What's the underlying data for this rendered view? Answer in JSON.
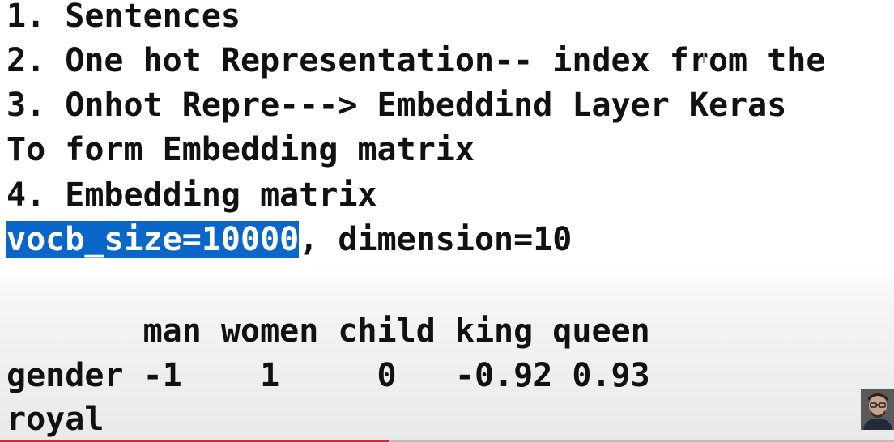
{
  "lines": [
    "1. Sentences",
    "2. One hot Representation-- index from the",
    "3. Onhot Repre---> Embeddind Layer Keras",
    "To form Embedding matrix",
    "4. Embedding matrix"
  ],
  "selection_line": {
    "selected_text": "vocb_size=10000",
    "rest_text": ", dimension=10"
  },
  "table_header": "       man women child king queen",
  "table_rows": [
    "gender -1    1     0   -0.92 0.93",
    "royal"
  ],
  "colors": {
    "selection": "#0a66c9",
    "progress": "#e0242b",
    "text": "#111111"
  },
  "video_progress": 0.435,
  "icons": {
    "cursor": "i-beam-cursor-icon",
    "avatar": "presenter-avatar-icon"
  }
}
